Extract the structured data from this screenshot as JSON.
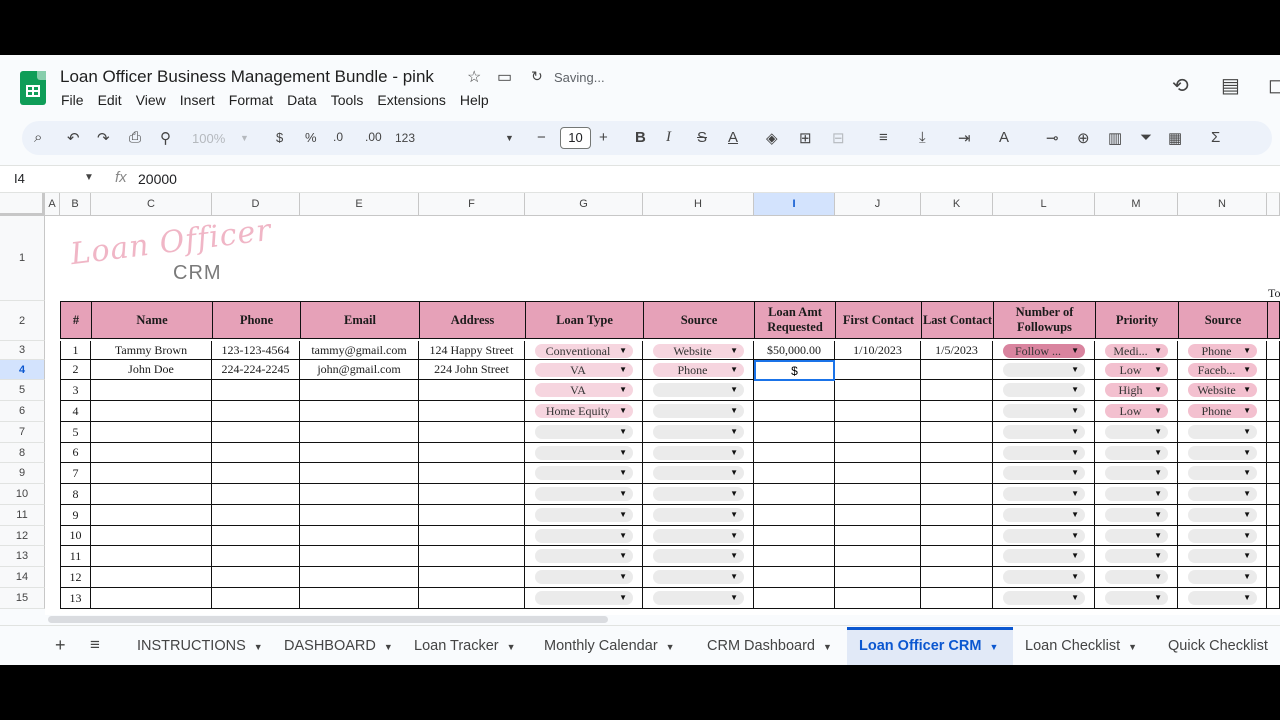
{
  "doc": {
    "title": "Loan Officer Business Management Bundle - pink",
    "status": "Saving..."
  },
  "menu": [
    "File",
    "Edit",
    "View",
    "Insert",
    "Format",
    "Data",
    "Tools",
    "Extensions",
    "Help"
  ],
  "toolbar": {
    "zoom": "100%",
    "currency": "$",
    "percent": "%",
    "dec_decrease": ".0",
    "dec_increase": ".00",
    "number_format": "123",
    "font_size": "10"
  },
  "formula_bar": {
    "cell_ref": "I4",
    "fx": "fx",
    "value": "20000"
  },
  "columns": [
    "A",
    "B",
    "C",
    "D",
    "E",
    "F",
    "G",
    "H",
    "I",
    "J",
    "K",
    "L",
    "M",
    "N"
  ],
  "row_numbers": [
    "1",
    "2",
    "3",
    "4",
    "5",
    "6",
    "7",
    "8",
    "9",
    "10",
    "11",
    "12",
    "13",
    "14",
    "15"
  ],
  "crm_logo": {
    "script": "Loan Officer",
    "word": "CRM"
  },
  "partial_text": "To",
  "table_headers": [
    "#",
    "Name",
    "Phone",
    "Email",
    "Address",
    "Loan Type",
    "Source",
    "Loan Amt Requested",
    "First Contact",
    "Last Contact",
    "Number of Followups",
    "Priority",
    "Source"
  ],
  "rows": [
    {
      "num": "1",
      "name": "Tammy Brown",
      "phone": "123-123-4564",
      "email": "tammy@gmail.com",
      "address": "124 Happy Street",
      "loan_type": "Conventional",
      "source": "Website",
      "amount": "$50,000.00",
      "first": "1/10/2023",
      "last": "1/5/2023",
      "followups": "Follow ...",
      "priority": "Medi...",
      "source2": "Phone"
    },
    {
      "num": "2",
      "name": "John Doe",
      "phone": "224-224-2245",
      "email": "john@gmail.com",
      "address": "224 John Street",
      "loan_type": "VA",
      "source": "Phone",
      "amount": "",
      "first": "",
      "last": "",
      "followups": "",
      "priority": "Low",
      "source2": "Faceb..."
    },
    {
      "num": "3",
      "name": "",
      "phone": "",
      "email": "",
      "address": "",
      "loan_type": "VA",
      "source": "",
      "amount": "",
      "first": "",
      "last": "",
      "followups": "",
      "priority": "High",
      "source2": "Website"
    },
    {
      "num": "4",
      "name": "",
      "phone": "",
      "email": "",
      "address": "",
      "loan_type": "Home Equity",
      "source": "",
      "amount": "",
      "first": "",
      "last": "",
      "followups": "",
      "priority": "Low",
      "source2": "Phone"
    },
    {
      "num": "5",
      "name": "",
      "phone": "",
      "email": "",
      "address": "",
      "loan_type": "",
      "source": "",
      "amount": "",
      "first": "",
      "last": "",
      "followups": "",
      "priority": "",
      "source2": ""
    },
    {
      "num": "6",
      "name": "",
      "phone": "",
      "email": "",
      "address": "",
      "loan_type": "",
      "source": "",
      "amount": "",
      "first": "",
      "last": "",
      "followups": "",
      "priority": "",
      "source2": ""
    },
    {
      "num": "7",
      "name": "",
      "phone": "",
      "email": "",
      "address": "",
      "loan_type": "",
      "source": "",
      "amount": "",
      "first": "",
      "last": "",
      "followups": "",
      "priority": "",
      "source2": ""
    },
    {
      "num": "8",
      "name": "",
      "phone": "",
      "email": "",
      "address": "",
      "loan_type": "",
      "source": "",
      "amount": "",
      "first": "",
      "last": "",
      "followups": "",
      "priority": "",
      "source2": ""
    },
    {
      "num": "9",
      "name": "",
      "phone": "",
      "email": "",
      "address": "",
      "loan_type": "",
      "source": "",
      "amount": "",
      "first": "",
      "last": "",
      "followups": "",
      "priority": "",
      "source2": ""
    },
    {
      "num": "10",
      "name": "",
      "phone": "",
      "email": "",
      "address": "",
      "loan_type": "",
      "source": "",
      "amount": "",
      "first": "",
      "last": "",
      "followups": "",
      "priority": "",
      "source2": ""
    },
    {
      "num": "11",
      "name": "",
      "phone": "",
      "email": "",
      "address": "",
      "loan_type": "",
      "source": "",
      "amount": "",
      "first": "",
      "last": "",
      "followups": "",
      "priority": "",
      "source2": ""
    },
    {
      "num": "12",
      "name": "",
      "phone": "",
      "email": "",
      "address": "",
      "loan_type": "",
      "source": "",
      "amount": "",
      "first": "",
      "last": "",
      "followups": "",
      "priority": "",
      "source2": ""
    },
    {
      "num": "13",
      "name": "",
      "phone": "",
      "email": "",
      "address": "",
      "loan_type": "",
      "source": "",
      "amount": "",
      "first": "",
      "last": "",
      "followups": "",
      "priority": "",
      "source2": ""
    }
  ],
  "editing_cell_text": "$",
  "chip_colors": {
    "followup": "#d9849f",
    "priority": "#f3c0cf",
    "source2": "#f3c0cf",
    "loan_type": "#f6d5df",
    "source": "#f6d5df",
    "empty": "#ebebeb"
  },
  "sheet_tabs": [
    "INSTRUCTIONS",
    "DASHBOARD",
    "Loan Tracker",
    "Monthly Calendar",
    "CRM Dashboard",
    "Loan Officer CRM",
    "Loan Checklist",
    "Quick Checklist"
  ],
  "active_tab": "Loan Officer CRM",
  "accent": "#0b57d0",
  "header_fill": "#e6a1b8"
}
